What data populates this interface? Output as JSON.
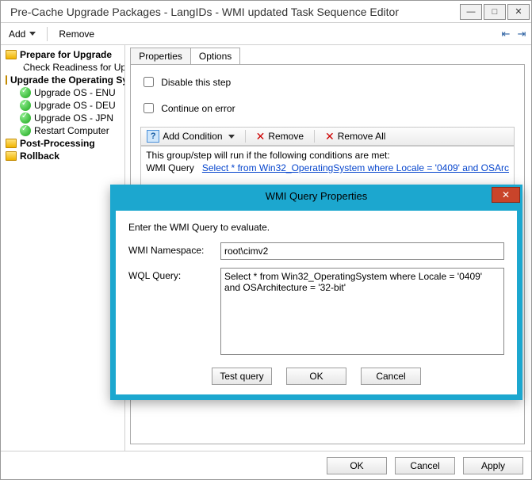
{
  "window": {
    "title": "Pre-Cache Upgrade Packages - LangIDs - WMI updated Task Sequence Editor"
  },
  "toolbar": {
    "add_label": "Add",
    "remove_label": "Remove"
  },
  "tree": {
    "items": [
      {
        "label": "Prepare for Upgrade",
        "bold": true,
        "icon": "folder",
        "indent": 0
      },
      {
        "label": "Check Readiness for Upgrade",
        "bold": false,
        "icon": "check",
        "indent": 1
      },
      {
        "label": "Upgrade the Operating System",
        "bold": true,
        "icon": "folder",
        "indent": 0
      },
      {
        "label": "Upgrade OS - ENU",
        "bold": false,
        "icon": "check",
        "indent": 1
      },
      {
        "label": "Upgrade OS - DEU",
        "bold": false,
        "icon": "check",
        "indent": 1
      },
      {
        "label": "Upgrade OS - JPN",
        "bold": false,
        "icon": "check",
        "indent": 1
      },
      {
        "label": "Restart Computer",
        "bold": false,
        "icon": "check",
        "indent": 1
      },
      {
        "label": "Post-Processing",
        "bold": true,
        "icon": "folder",
        "indent": 0
      },
      {
        "label": "Rollback",
        "bold": true,
        "icon": "folder",
        "indent": 0
      }
    ]
  },
  "tabs": {
    "properties": "Properties",
    "options": "Options"
  },
  "options": {
    "disable_label": "Disable this step",
    "continue_label": "Continue on error",
    "cond_toolbar": {
      "add": "Add Condition",
      "remove": "Remove",
      "remove_all": "Remove All"
    },
    "cond_desc": "This group/step will run if the following conditions are met:",
    "cond_prefix": "WMI Query",
    "cond_link": "Select * from Win32_OperatingSystem where Locale = '0409' and OSArc"
  },
  "dialog": {
    "title": "WMI Query Properties",
    "intro": "Enter the WMI Query to evaluate.",
    "ns_label": "WMI Namespace:",
    "ns_value": "root\\cimv2",
    "wql_label": "WQL Query:",
    "wql_value": "Select * from Win32_OperatingSystem where Locale = '0409' and OSArchitecture = '32-bit'",
    "test": "Test query",
    "ok": "OK",
    "cancel": "Cancel"
  },
  "bottom": {
    "ok": "OK",
    "cancel": "Cancel",
    "apply": "Apply"
  }
}
